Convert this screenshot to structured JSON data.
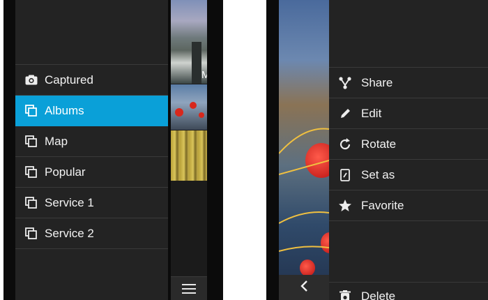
{
  "left_phone": {
    "menu": [
      {
        "label": "Captured",
        "icon": "camera-icon",
        "active": false
      },
      {
        "label": "Albums",
        "icon": "album-icon",
        "active": true
      },
      {
        "label": "Map",
        "icon": "album-icon",
        "active": false
      },
      {
        "label": "Popular",
        "icon": "album-icon",
        "active": false
      },
      {
        "label": "Service 1",
        "icon": "album-icon",
        "active": false
      },
      {
        "label": "Service 2",
        "icon": "album-icon",
        "active": false
      }
    ],
    "thumb_letter": "M",
    "accent_color": "#0aa0d8",
    "bottom_icon": "hamburger-menu-icon"
  },
  "right_phone": {
    "actions": [
      {
        "label": "Share",
        "icon": "share-icon"
      },
      {
        "label": "Edit",
        "icon": "pencil-icon"
      },
      {
        "label": "Rotate",
        "icon": "rotate-icon"
      },
      {
        "label": "Set as",
        "icon": "set-as-icon"
      },
      {
        "label": "Favorite",
        "icon": "star-icon"
      }
    ],
    "delete_label": "Delete",
    "back_icon": "chevron-left-icon"
  }
}
